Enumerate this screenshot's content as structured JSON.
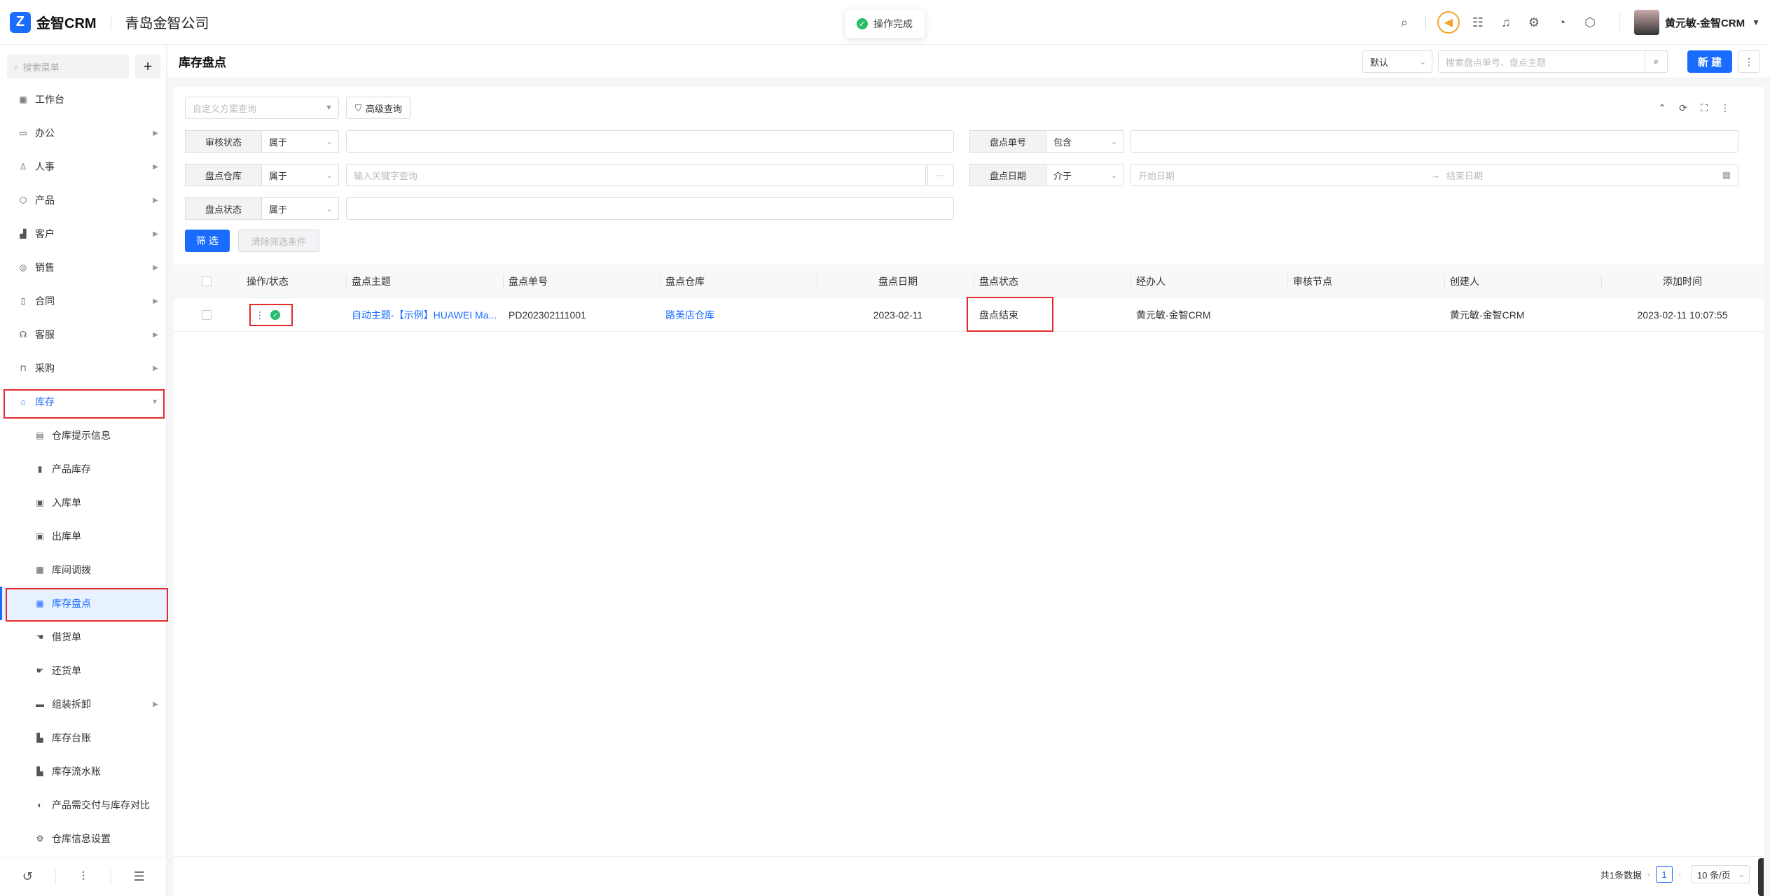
{
  "header": {
    "logo_mark": "Z",
    "logo_text": "金智CRM",
    "company": "青岛金智公司",
    "toast": "操作完成",
    "user_name": "黄元敏-金智CRM"
  },
  "sidebar": {
    "search_placeholder": "搜索菜单",
    "add_label": "+",
    "menu": [
      {
        "label": "工作台",
        "icon": "grid-icon"
      },
      {
        "label": "办公",
        "icon": "tray-icon"
      },
      {
        "label": "人事",
        "icon": "person-icon"
      },
      {
        "label": "产品",
        "icon": "cube-icon"
      },
      {
        "label": "客户",
        "icon": "chart-icon"
      },
      {
        "label": "销售",
        "icon": "target-icon"
      },
      {
        "label": "合同",
        "icon": "document-icon"
      },
      {
        "label": "客服",
        "icon": "headset-icon"
      },
      {
        "label": "采购",
        "icon": "bag-icon"
      },
      {
        "label": "库存",
        "icon": "warehouse-icon"
      }
    ],
    "submenu": [
      {
        "label": "仓库提示信息",
        "icon": "note-icon"
      },
      {
        "label": "产品库存",
        "icon": "file-icon"
      },
      {
        "label": "入库单",
        "icon": "inbound-icon"
      },
      {
        "label": "出库单",
        "icon": "outbound-icon"
      },
      {
        "label": "库间调拨",
        "icon": "transfer-icon"
      },
      {
        "label": "库存盘点",
        "icon": "inventory-icon"
      },
      {
        "label": "借货单",
        "icon": "borrow-icon"
      },
      {
        "label": "还货单",
        "icon": "return-icon"
      },
      {
        "label": "组装拆卸",
        "icon": "assembly-icon"
      },
      {
        "label": "库存台账",
        "icon": "ledger-icon"
      },
      {
        "label": "库存流水账",
        "icon": "flow-icon"
      },
      {
        "label": "产品需交付与库存对比",
        "icon": "compare-icon"
      },
      {
        "label": "仓库信息设置",
        "icon": "settings-icon"
      }
    ]
  },
  "page": {
    "title": "库存盘点",
    "view_select": "默认",
    "search_placeholder": "搜索盘点单号、盘点主题",
    "new_button": "新 建"
  },
  "filters": {
    "scheme_placeholder": "自定义方案查询",
    "advanced": "高级查询",
    "rows": [
      {
        "label": "审核状态",
        "op": "属于",
        "value": ""
      },
      {
        "label": "盘点单号",
        "op": "包含",
        "value": ""
      },
      {
        "label": "盘点仓库",
        "op": "属于",
        "value": "输入关键字查询"
      },
      {
        "label": "盘点日期",
        "op": "介于",
        "start": "开始日期",
        "end": "结束日期"
      },
      {
        "label": "盘点状态",
        "op": "属于",
        "value": ""
      }
    ],
    "filter_button": "筛 选",
    "clear_button": "清除筛选条件"
  },
  "table": {
    "columns": [
      "操作/状态",
      "盘点主题",
      "盘点单号",
      "盘点仓库",
      "盘点日期",
      "盘点状态",
      "经办人",
      "审核节点",
      "创建人",
      "添加时间"
    ],
    "rows": [
      {
        "subject": "自动主题-【示例】HUAWEI Ma...",
        "number": "PD202302111001",
        "warehouse": "路美店仓库",
        "date": "2023-02-11",
        "status": "盘点结束",
        "handler": "黄元敏-金智CRM",
        "audit_node": "",
        "creator": "黄元敏-金智CRM",
        "added": "2023-02-11 10:07:55"
      }
    ]
  },
  "pager": {
    "total": "共1条数据",
    "page": "1",
    "size": "10 条/页"
  },
  "colors": {
    "primary": "#1a6cff",
    "highlight_box": "#e52a2a",
    "success": "#2bbd6e",
    "accent": "#f3a52b"
  }
}
